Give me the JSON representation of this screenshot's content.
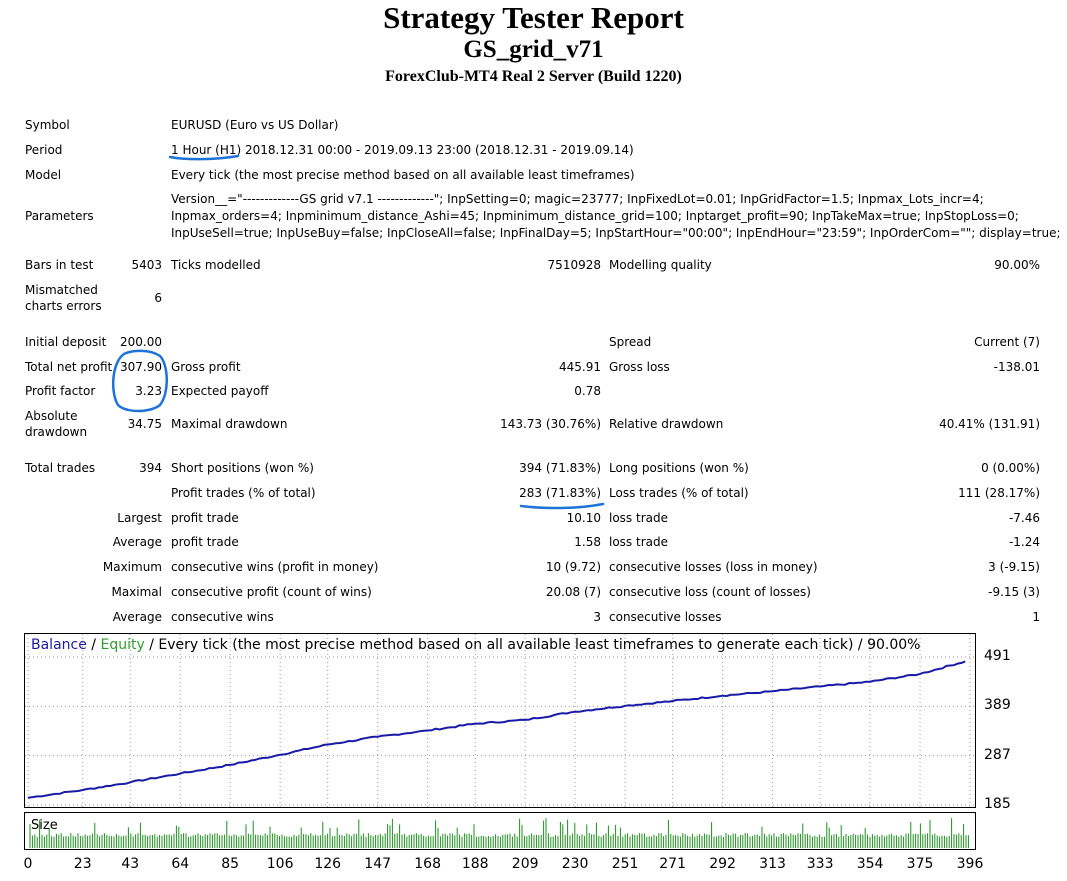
{
  "header": {
    "title": "Strategy Tester Report",
    "expert": "GS_grid_v71",
    "server": "ForexClub-MT4 Real 2 Server (Build 1220)"
  },
  "info": {
    "symbol_label": "Symbol",
    "symbol_value": "EURUSD (Euro vs US Dollar)",
    "period_label": "Period",
    "period_value": "1 Hour (H1) 2018.12.31 00:00 - 2019.09.13 23:00 (2018.12.31 - 2019.09.14)",
    "model_label": "Model",
    "model_value": "Every tick (the most precise method based on all available least timeframes)",
    "parameters_label": "Parameters",
    "parameters_lines": [
      "Version__=\"-------------GS grid v7.1 -------------\"; InpSetting=0; magic=23777; InpFixedLot=0.01; InpGridFactor=1.5; Inpmax_Lots_incr=4;",
      "Inpmax_orders=4; Inpminimum_distance_Ashi=45; Inpminimum_distance_grid=100; Inptarget_profit=90; InpTakeMax=true; InpStopLoss=0;",
      "InpUseSell=true; InpUseBuy=false; InpCloseAll=false; InpFinalDay=5; InpStartHour=\"00:00\"; InpEndHour=\"23:59\"; InpOrderCom=\"\"; display=true;"
    ]
  },
  "stats": {
    "bars_label": "Bars in test",
    "bars_value": "5403",
    "ticks_label": "Ticks modelled",
    "ticks_value": "7510928",
    "quality_label": "Modelling quality",
    "quality_value": "90.00%",
    "mismatched_label_1": "Mismatched",
    "mismatched_label_2": "charts errors",
    "mismatched_value": "6",
    "initial_label": "Initial deposit",
    "initial_value": "200.00",
    "spread_label": "Spread",
    "spread_value": "Current (7)",
    "netprofit_label": "Total net profit",
    "netprofit_value": "307.90",
    "grossprofit_label": "Gross profit",
    "grossprofit_value": "445.91",
    "grossloss_label": "Gross loss",
    "grossloss_value": "-138.01",
    "pf_label": "Profit factor",
    "pf_value": "3.23",
    "payoff_label": "Expected payoff",
    "payoff_value": "0.78",
    "absdd_label_1": "Absolute",
    "absdd_label_2": "drawdown",
    "absdd_value": "34.75",
    "maxdd_label": "Maximal drawdown",
    "maxdd_value": "143.73 (30.76%)",
    "reldd_label": "Relative drawdown",
    "reldd_value": "40.41% (131.91)",
    "trades_label": "Total trades",
    "trades_value": "394",
    "short_label": "Short positions (won %)",
    "short_value": "394 (71.83%)",
    "long_label": "Long positions (won %)",
    "long_value": "0 (0.00%)",
    "profittrades_label": "Profit trades (% of total)",
    "profittrades_value": "283 (71.83%)",
    "losstrades_label": "Loss trades (% of total)",
    "losstrades_value": "111 (28.17%)",
    "largest": "Largest",
    "average": "Average",
    "maximum": "Maximum",
    "maximal": "Maximal",
    "profit_trade": "profit trade",
    "loss_trade": "loss trade",
    "largest_profit": "10.10",
    "largest_loss": "-7.46",
    "average_profit": "1.58",
    "average_loss": "-1.24",
    "cons_wins_label": "consecutive wins (profit in money)",
    "cons_wins_value": "10 (9.72)",
    "cons_losses_label": "consecutive losses (loss in money)",
    "cons_losses_value": "3 (-9.15)",
    "cons_profit_label": "consecutive profit (count of wins)",
    "cons_profit_value": "20.08 (7)",
    "cons_loss_label": "consecutive loss (count of losses)",
    "cons_loss_value": "-9.15 (3)",
    "avg_cons_wins_label": "consecutive wins",
    "avg_cons_wins_value": "3",
    "avg_cons_losses_label": "consecutive losses",
    "avg_cons_losses_value": "1"
  },
  "chart_caption": {
    "balance": "Balance",
    "sep1": " / ",
    "equity": "Equity",
    "rest": " / Every tick (the most precise method based on all available least timeframes to generate each tick) / 90.00%"
  },
  "size_label": "Size",
  "colors": {
    "balance": "#1a1aa8",
    "equity": "#2e9e2e",
    "size_bars": "#1f8f1f",
    "annotation": "#1e73d8"
  },
  "chart_data": {
    "type": "line",
    "series": [
      {
        "name": "Balance",
        "x": [
          0,
          23,
          43,
          64,
          85,
          106,
          126,
          147,
          168,
          188,
          209,
          230,
          251,
          271,
          292,
          313,
          333,
          354,
          375,
          394
        ],
        "y": [
          200,
          216,
          232,
          250,
          268,
          289,
          310,
          326,
          339,
          353,
          361,
          378,
          390,
          400,
          411,
          420,
          430,
          440,
          456,
          482
        ]
      }
    ],
    "x_ticks": [
      "0",
      "23",
      "43",
      "64",
      "85",
      "106",
      "126",
      "147",
      "168",
      "188",
      "209",
      "230",
      "251",
      "271",
      "292",
      "313",
      "333",
      "354",
      "375",
      "396"
    ],
    "y_ticks": [
      "491",
      "389",
      "287",
      "185"
    ],
    "xlim": [
      0,
      396
    ],
    "ylim": [
      185,
      491
    ],
    "grid": true
  }
}
